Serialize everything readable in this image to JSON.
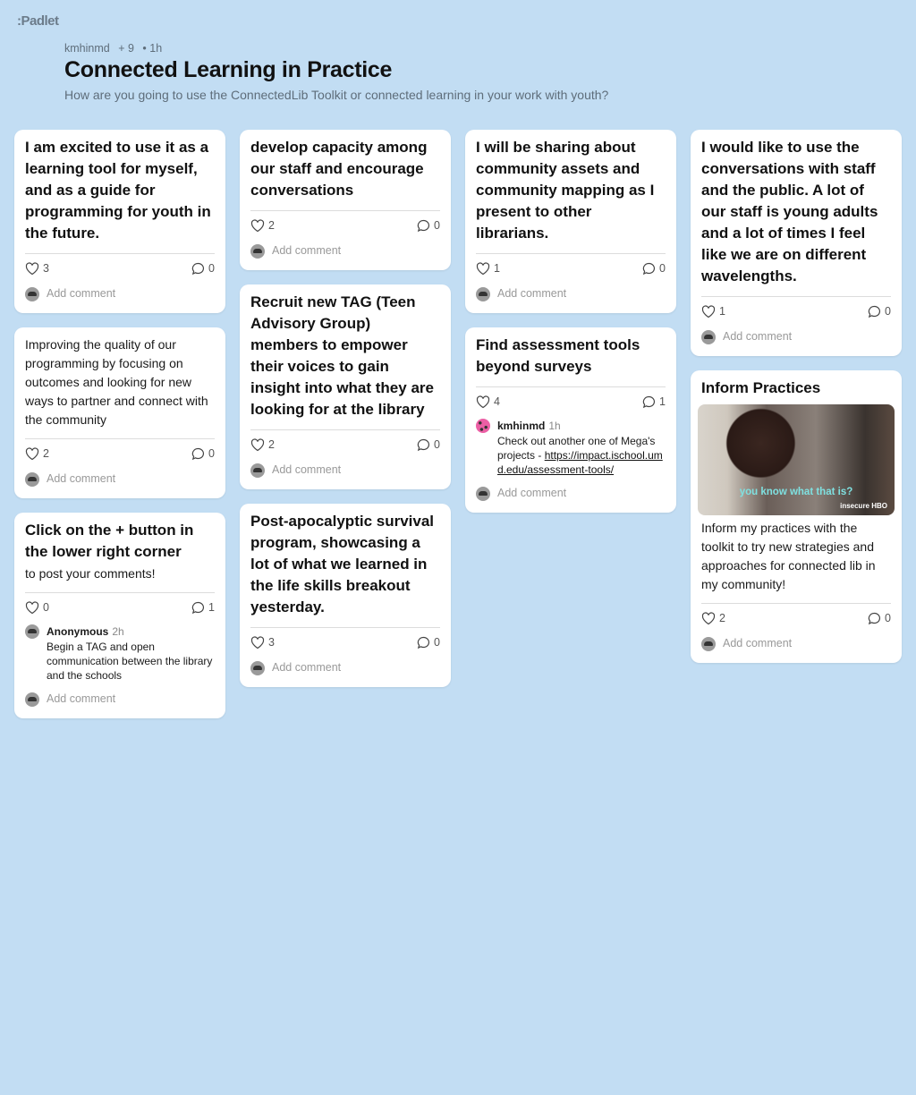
{
  "app": {
    "logo": ":Padlet"
  },
  "header": {
    "author": "kmhinmd",
    "contributors": "+ 9",
    "time": "• 1h",
    "title": "Connected Learning in Practice",
    "subtitle": "How are you going to use the ConnectedLib Toolkit or connected learning in your work with youth?"
  },
  "add_comment_label": "Add comment",
  "columns": [
    [
      {
        "title": "I am excited to use it as a learning tool for myself, and as a guide for programming for youth in the future.",
        "likes": "3",
        "comments_count": "0",
        "comments": []
      },
      {
        "body": "Improving the quality of our programming by focusing on outcomes and looking for new ways to partner and connect with the community",
        "likes": "2",
        "comments_count": "0",
        "comments": []
      },
      {
        "title": "Click on the + button in the lower right corner",
        "body": "to post your comments!",
        "likes": "0",
        "comments_count": "1",
        "comments": [
          {
            "author": "Anonymous",
            "time": "2h",
            "text": "Begin a TAG and open communication between the library and the schools",
            "avatar": "gray"
          }
        ]
      }
    ],
    [
      {
        "title": "develop capacity among our staff and encourage conversations",
        "likes": "2",
        "comments_count": "0",
        "comments": []
      },
      {
        "title": "Recruit new TAG (Teen Advisory Group) members to empower their voices to gain insight into what they are looking for at the library",
        "likes": "2",
        "comments_count": "0",
        "comments": []
      },
      {
        "title": "Post-apocalyptic survival program, showcasing a lot of what we learned in the life skills breakout yesterday.",
        "likes": "3",
        "comments_count": "0",
        "comments": []
      }
    ],
    [
      {
        "title": "I will be sharing about community assets and community mapping as I present to other librarians.",
        "likes": "1",
        "comments_count": "0",
        "comments": []
      },
      {
        "title": "Find assessment tools beyond surveys",
        "likes": "4",
        "comments_count": "1",
        "comments": [
          {
            "author": "kmhinmd",
            "time": "1h",
            "text": "Check out another one of Mega's projects - ",
            "link": "https://impact.ischool.umd.edu/assessment-tools/",
            "avatar": "pink"
          }
        ]
      }
    ],
    [
      {
        "title": "I would like to use the conversations with staff and the public. A lot of our staff is young adults and a lot of times I feel like we are on different wavelengths.",
        "likes": "1",
        "comments_count": "0",
        "comments": []
      },
      {
        "title": "Inform Practices",
        "image": {
          "caption": "you know what that is?",
          "watermark": "insecure HBO"
        },
        "body": "Inform my practices with the toolkit to try new strategies and approaches for connected lib in my community!",
        "likes": "2",
        "comments_count": "0",
        "comments": []
      }
    ]
  ]
}
